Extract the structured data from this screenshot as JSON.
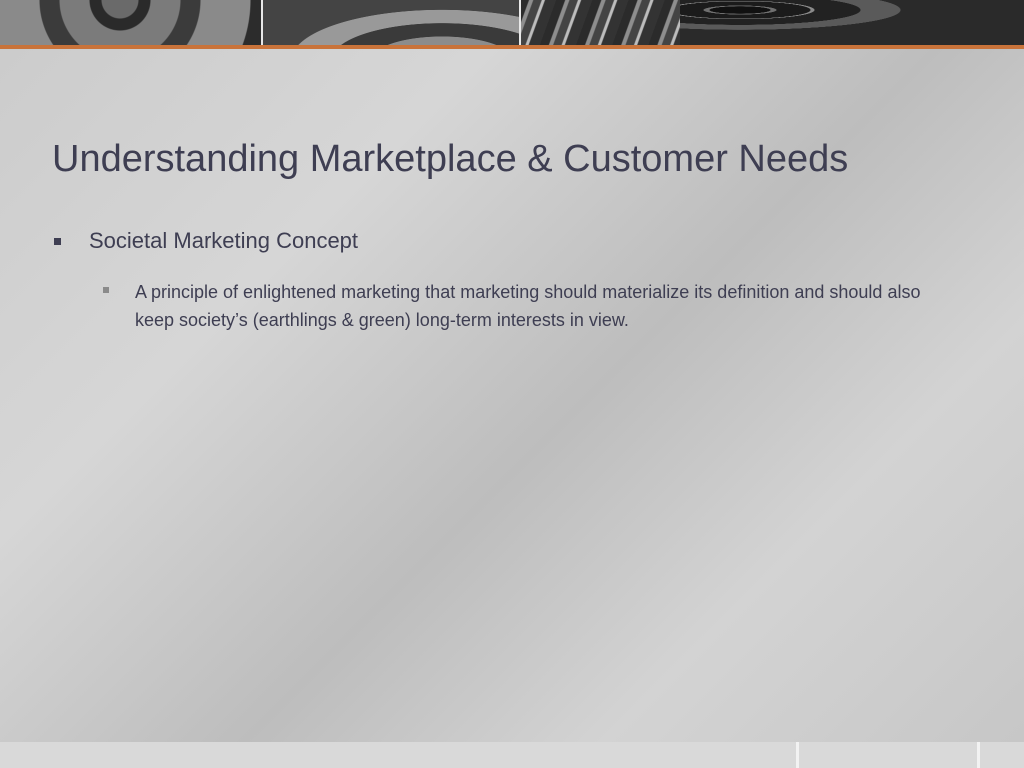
{
  "slide": {
    "title": "Understanding Marketplace & Customer Needs",
    "bullets": [
      {
        "text": "Societal Marketing Concept",
        "sub_bullets": [
          {
            "text": "A principle of enlightened marketing that marketing should materialize its definition and should also keep society’s (earthlings & green) long-term interests in view."
          }
        ]
      }
    ]
  },
  "colors": {
    "accent": "#c9733a",
    "text": "#3e3e52",
    "background": "#cfcfcf"
  }
}
